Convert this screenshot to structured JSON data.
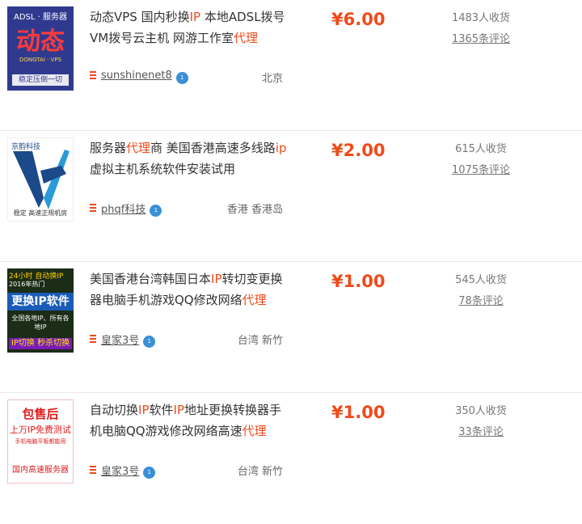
{
  "items": [
    {
      "thumb": {
        "line1": "ADSL · 服务器",
        "line2": "动态",
        "line3": "DONGTAI · VPS",
        "line4": "稳定压倒一切"
      },
      "title": [
        {
          "t": "动态VPS 国内秒换",
          "h": false
        },
        {
          "t": "IP",
          "h": true
        },
        {
          "t": " 本地ADSL拨号VM拨号云主机 网游工作室",
          "h": false
        },
        {
          "t": "代理",
          "h": true
        }
      ],
      "seller": "sunshinenet8",
      "location": "北京",
      "price": "¥6.00",
      "sales": "1483人收货",
      "reviews": "1365条评论"
    },
    {
      "thumb": {
        "line1": "京韵科技",
        "line4": "稳定 高速正规机房"
      },
      "title": [
        {
          "t": "服务器",
          "h": false
        },
        {
          "t": "代理",
          "h": true
        },
        {
          "t": "商 美国香港高速多线路",
          "h": false
        },
        {
          "t": "ip",
          "h": true
        },
        {
          "t": "虚拟主机系统软件安装试用",
          "h": false
        }
      ],
      "seller": "phqf科技",
      "location": "香港 香港岛",
      "price": "¥2.00",
      "sales": "615人收货",
      "reviews": "1075条评论"
    },
    {
      "thumb": {
        "line1": "24小时 自动换IP",
        "line2": "2016年热门",
        "line3": "更换IP软件",
        "line4": "全国各地IP、所有各地IP",
        "line5": "IP切换 秒杀切换"
      },
      "title": [
        {
          "t": "美国香港台湾韩国日本",
          "h": false
        },
        {
          "t": "IP",
          "h": true
        },
        {
          "t": "转切变更换器电脑手机游戏QQ修改网络",
          "h": false
        },
        {
          "t": "代理",
          "h": true
        }
      ],
      "seller": "皇家3号",
      "location": "台湾 新竹",
      "price": "¥1.00",
      "sales": "545人收货",
      "reviews": "78条评论"
    },
    {
      "thumb": {
        "line1": "包售后",
        "line2": "上万IP免费测试",
        "line3": "手机电脑平板都能用",
        "line4": "国内高速服务器"
      },
      "title": [
        {
          "t": "自动切换",
          "h": false
        },
        {
          "t": "IP",
          "h": true
        },
        {
          "t": "软件",
          "h": false
        },
        {
          "t": "IP",
          "h": true
        },
        {
          "t": "地址更换转换器手机电脑QQ游戏修改网络高速",
          "h": false
        },
        {
          "t": "代理",
          "h": true
        }
      ],
      "seller": "皇家3号",
      "location": "台湾 新竹",
      "price": "¥1.00",
      "sales": "350人收货",
      "reviews": "33条评论"
    }
  ],
  "badge_text": "1",
  "colors": {
    "accent": "#f04a1a",
    "badge": "#3a8fd6",
    "divider": "#e8e8e8"
  }
}
